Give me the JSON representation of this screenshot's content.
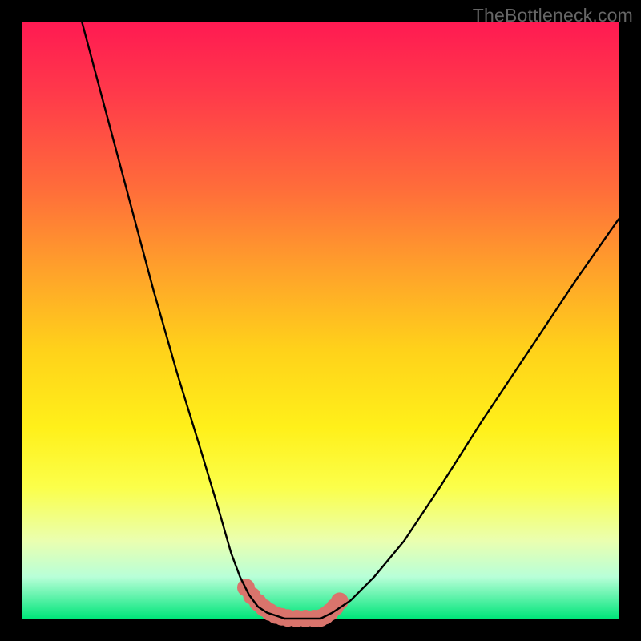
{
  "watermark": "TheBottleneck.com",
  "chart_data": {
    "type": "line",
    "title": "",
    "xlabel": "",
    "ylabel": "",
    "xlim": [
      0,
      100
    ],
    "ylim": [
      0,
      100
    ],
    "series": [
      {
        "name": "left-curve",
        "x": [
          10,
          14,
          18,
          22,
          26,
          30,
          33,
          35,
          36.5,
          38,
          39.5,
          41,
          42.5,
          44
        ],
        "y": [
          100,
          85,
          70,
          55,
          41,
          28,
          18,
          11,
          7,
          4,
          2,
          1,
          0.5,
          0
        ]
      },
      {
        "name": "bottom-flat",
        "x": [
          44,
          46,
          48,
          50
        ],
        "y": [
          0,
          0,
          0,
          0
        ]
      },
      {
        "name": "right-curve",
        "x": [
          50,
          52,
          55,
          59,
          64,
          70,
          77,
          85,
          93,
          100
        ],
        "y": [
          0,
          1,
          3,
          7,
          13,
          22,
          33,
          45,
          57,
          67
        ]
      }
    ],
    "highlight_band": {
      "name": "salmon-markers",
      "x": [
        37.5,
        38.5,
        39.5,
        40.5,
        41.5,
        42.5,
        43.5,
        44.5,
        46,
        47.5,
        49,
        50,
        50.8,
        51.6,
        52.4,
        53.2
      ],
      "y": [
        5.2,
        3.8,
        2.7,
        1.8,
        1.1,
        0.6,
        0.3,
        0.1,
        0,
        0,
        0,
        0.1,
        0.5,
        1.1,
        1.9,
        2.9
      ]
    },
    "colors": {
      "curve": "#000000",
      "highlight": "#d9746c",
      "gradient_top": "#ff1a52",
      "gradient_bottom": "#00e57a"
    }
  }
}
